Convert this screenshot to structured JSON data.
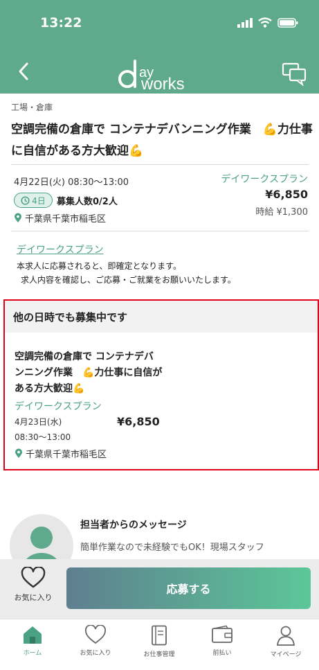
{
  "status_bar": {
    "time": "13:22"
  },
  "header": {
    "logo_text": "dayworks"
  },
  "job": {
    "category": "工場・倉庫",
    "title": "空調完備の倉庫で コンテナデバンニング作業　💪力仕事に自信がある方大歓迎💪",
    "date": "4月22日(火) 08:30〜13:00",
    "plan": "デイワークスプラン",
    "days_badge": "4日",
    "recruit": "募集人数0/2人",
    "price": "¥6,850",
    "hourly": "時給 ¥1,300",
    "location": "千葉県千葉市稲毛区"
  },
  "plan_info": {
    "link": "デイワークスプラン",
    "desc1": "本求人に応募されると、即確定となります。",
    "desc2": "求人内容を確認し、ご応募・ご就業をお願いいたします。"
  },
  "other_dates": {
    "heading": "他の日時でも募集中です",
    "title": "空調完備の倉庫で コンテナデバンニング作業　💪力仕事に自信がある方大歓迎💪",
    "plan": "デイワークスプラン",
    "date": "4月23日(水)",
    "time": "08:30〜13:00",
    "price": "¥6,850",
    "location": "千葉県千葉市稲毛区"
  },
  "message": {
    "heading": "担当者からのメッセージ",
    "text": "簡単作業なので未経験でもOK！現場スタッフ"
  },
  "actions": {
    "favorite": "お気に入り",
    "apply": "応募する"
  },
  "tabs": [
    {
      "label": "ホーム",
      "icon": "home-icon"
    },
    {
      "label": "お気に入り",
      "icon": "heart-icon"
    },
    {
      "label": "お仕事管理",
      "icon": "notebook-icon"
    },
    {
      "label": "前払い",
      "icon": "wallet-icon"
    },
    {
      "label": "マイページ",
      "icon": "person-icon"
    }
  ],
  "colors": {
    "brand": "#5fa98c",
    "accent": "#4aa283",
    "highlight_border": "#e0001a"
  }
}
